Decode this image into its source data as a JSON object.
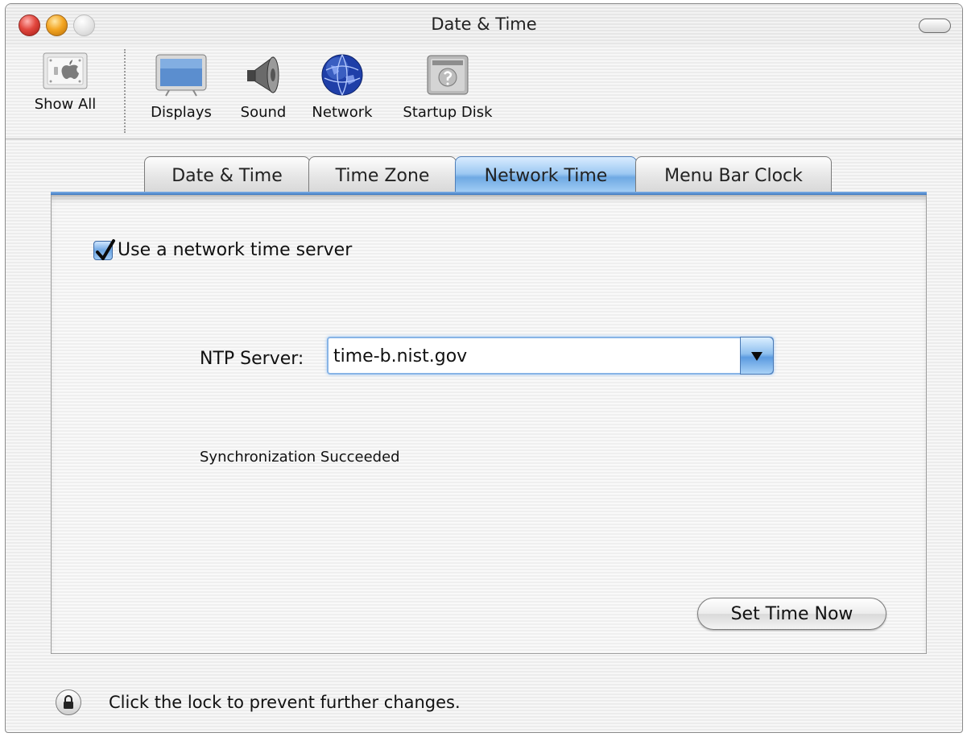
{
  "window": {
    "title": "Date & Time"
  },
  "toolbar": {
    "items": [
      {
        "label": "Show All",
        "icon": "apple-icon"
      },
      {
        "label": "Displays",
        "icon": "display-icon"
      },
      {
        "label": "Sound",
        "icon": "speaker-icon"
      },
      {
        "label": "Network",
        "icon": "globe-icon"
      },
      {
        "label": "Startup Disk",
        "icon": "disk-icon"
      }
    ]
  },
  "tabs": [
    {
      "label": "Date & Time",
      "active": false
    },
    {
      "label": "Time Zone",
      "active": false
    },
    {
      "label": "Network Time",
      "active": true
    },
    {
      "label": "Menu Bar Clock",
      "active": false
    }
  ],
  "network_time": {
    "use_server_label": "Use a network time server",
    "use_server_checked": true,
    "ntp_label": "NTP Server:",
    "ntp_value": "time-b.nist.gov",
    "status": "Synchronization Succeeded",
    "set_time_button": "Set Time Now"
  },
  "footer": {
    "lock_text": "Click the lock to prevent further changes."
  },
  "colors": {
    "accent": "#6fa9e3",
    "close": "#e2473e",
    "minimize": "#f4a623"
  }
}
